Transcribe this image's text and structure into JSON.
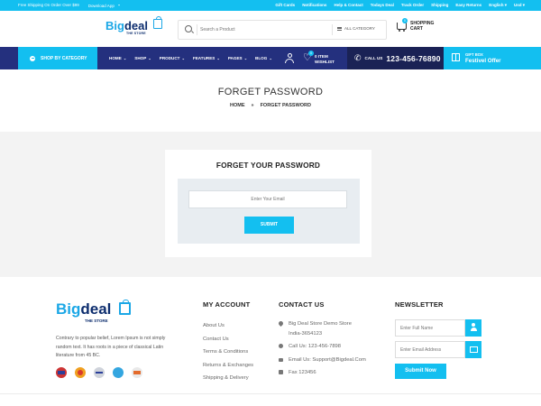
{
  "topbar": {
    "shipping": "Free Shipping On Order Over $99",
    "download": "Download App",
    "links": [
      "Gift Cards",
      "Notifications",
      "Help & Contact",
      "Todays Deal",
      "Track Order",
      "Shipping",
      "Easy Returns",
      "English",
      "Usd"
    ]
  },
  "header": {
    "logo_big": "Big",
    "logo_deal": "deal",
    "logo_sub": "THE STORE",
    "search_placeholder": "Search a Product",
    "category_label": "ALL CATEGORY",
    "cart_count": "0",
    "cart_label_1": "SHOPPING",
    "cart_label_2": "CART"
  },
  "nav": {
    "shop_by_category": "SHOP BY CATEGORY",
    "menu": [
      {
        "label": "HOME"
      },
      {
        "label": "SHOP"
      },
      {
        "label": "PRODUCT"
      },
      {
        "label": "FEATURES"
      },
      {
        "label": "PAGES"
      },
      {
        "label": "BLOG"
      }
    ],
    "wishlist_count": "0",
    "wishlist_line1": "0 ITEM",
    "wishlist_line2": "WISHLIST",
    "call_us": "CALL US",
    "phone": "123-456-76890",
    "gift_line1": "GIFT BOX",
    "gift_line2": "Festivel Offer"
  },
  "page": {
    "title": "FORGET PASSWORD",
    "breadcrumb_home": "HOME",
    "breadcrumb_sep": "»",
    "breadcrumb_current": "FORGET PASSWORD"
  },
  "form": {
    "heading": "FORGET YOUR PASSWORD",
    "email_placeholder": "Enter Your Email",
    "submit_label": "SUBMIT"
  },
  "footer": {
    "logo_big": "Big",
    "logo_deal": "deal",
    "logo_sub": "THE STORE",
    "description": "Contrary to popular belief, Lorem Ipsum is not simply random text. It has roots in a piece of classical Latin literature from 45 BC.",
    "account_heading": "MY ACCOUNT",
    "account_links": [
      "About Us",
      "Contact Us",
      "Terms & Conditions",
      "Returns & Exchanges",
      "Shipping & Delivery"
    ],
    "contact_heading": "CONTACT US",
    "address_line1": "Big Deal Store Demo Store",
    "address_line2": "India-3654123",
    "call": "Call Us: 123-456-7898",
    "email": "Email Us: Support@Bigdeal.Com",
    "fax": "Fax 123456",
    "newsletter_heading": "NEWSLETTER",
    "name_placeholder": "Enter Full Name",
    "email_placeholder": "Enter Email Address",
    "submit_label": "Submit Now"
  },
  "colors": {
    "accent": "#13bff0",
    "nav_bg": "#24307e",
    "call_bg": "#1a2255"
  }
}
